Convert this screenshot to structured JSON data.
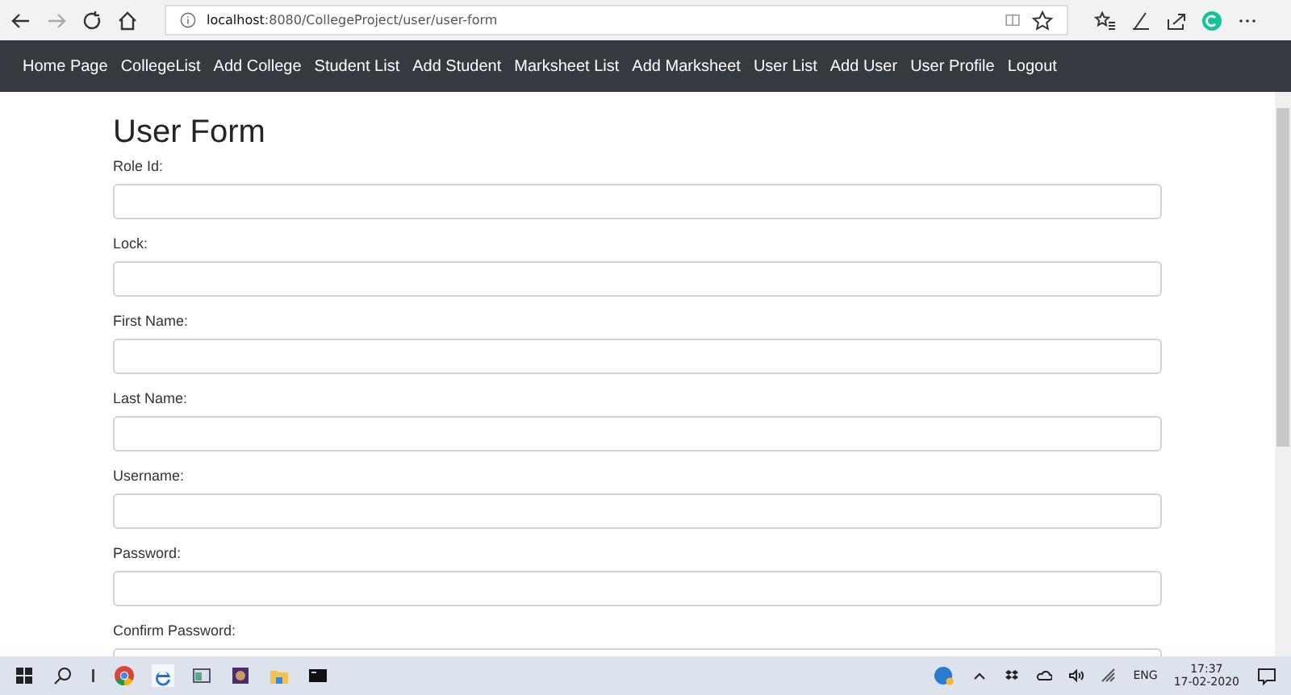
{
  "browser": {
    "url_host": "localhost",
    "url_rest": ":8080/CollegeProject/user/user-form"
  },
  "nav": {
    "items": [
      "Home Page",
      "CollegeList",
      "Add College",
      "Student List",
      "Add Student",
      "Marksheet List",
      "Add Marksheet",
      "User List",
      "Add User",
      "User Profile",
      "Logout"
    ]
  },
  "form": {
    "title": "User Form",
    "fields": [
      {
        "label": "Role Id:"
      },
      {
        "label": "Lock:"
      },
      {
        "label": "First Name:"
      },
      {
        "label": "Last Name:"
      },
      {
        "label": "Username:"
      },
      {
        "label": "Password:"
      },
      {
        "label": "Confirm Password:"
      }
    ]
  },
  "taskbar": {
    "language": "ENG",
    "time": "17:37",
    "date": "17-02-2020"
  }
}
